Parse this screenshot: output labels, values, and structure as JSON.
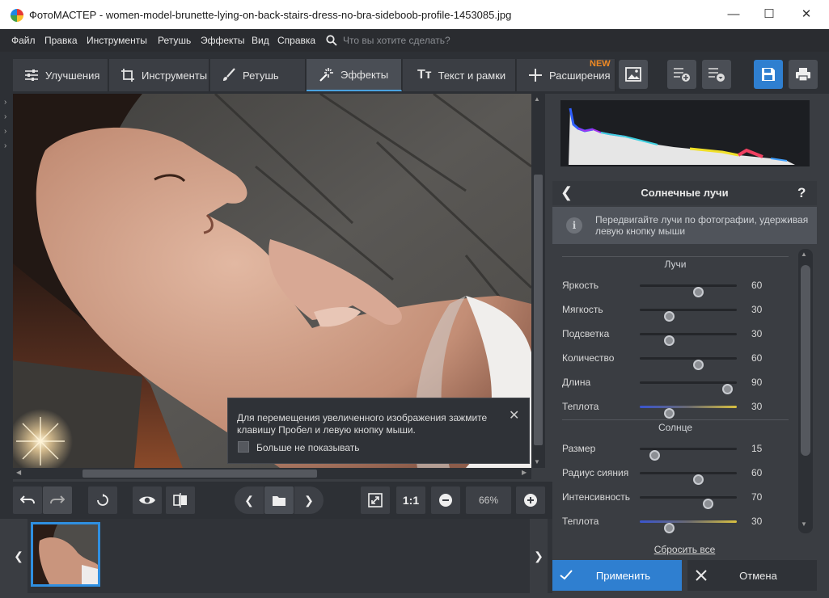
{
  "window": {
    "title": "ФотоМАСТЕР - women-model-brunette-lying-on-back-stairs-dress-no-bra-sideboob-profile-1453085.jpg",
    "minimize": "—",
    "maximize": "☐",
    "close": "✕"
  },
  "menu": {
    "items": [
      "Файл",
      "Правка",
      "Инструменты",
      "Ретушь",
      "Эффекты",
      "Вид",
      "Справка"
    ],
    "search_placeholder": "Что вы хотите сделать?"
  },
  "tabs": [
    {
      "label": "Улучшения",
      "icon": "sliders-icon"
    },
    {
      "label": "Инструменты",
      "icon": "crop-icon"
    },
    {
      "label": "Ретушь",
      "icon": "brush-icon"
    },
    {
      "label": "Эффекты",
      "icon": "magic-wand-icon",
      "active": true
    },
    {
      "label": "Текст и рамки",
      "icon": "text-icon"
    },
    {
      "label": "Расширения",
      "icon": "plus-icon"
    }
  ],
  "new_badge": "NEW",
  "tooltip": {
    "text": "Для перемещения увеличенного изображения зажмите клавишу Пробел и левую кнопку мыши.",
    "checkbox_label": "Больше не показывать",
    "checked": false
  },
  "bottombar": {
    "one_to_one": "1:1",
    "zoom": "66%"
  },
  "effect": {
    "title": "Солнечные лучи",
    "help": "?",
    "info": "Передвигайте лучи по фотографии, удерживая левую кнопку мыши",
    "rays_section": "Лучи",
    "sun_section": "Солнце",
    "rays": [
      {
        "label": "Яркость",
        "value": 60
      },
      {
        "label": "Мягкость",
        "value": 30
      },
      {
        "label": "Подсветка",
        "value": 30
      },
      {
        "label": "Количество",
        "value": 60
      },
      {
        "label": "Длина",
        "value": 90
      },
      {
        "label": "Теплота",
        "value": 30,
        "gradient": true
      }
    ],
    "sun": [
      {
        "label": "Размер",
        "value": 15
      },
      {
        "label": "Радиус сияния",
        "value": 60
      },
      {
        "label": "Интенсивность",
        "value": 70
      },
      {
        "label": "Теплота",
        "value": 30,
        "gradient": true
      }
    ],
    "reset": "Сбросить все"
  },
  "actions": {
    "apply": "Применить",
    "cancel": "Отмена"
  },
  "colors": {
    "accent": "#2f7fd0",
    "active_tab_underline": "#4aa3e0",
    "new_badge": "#f08a24"
  }
}
